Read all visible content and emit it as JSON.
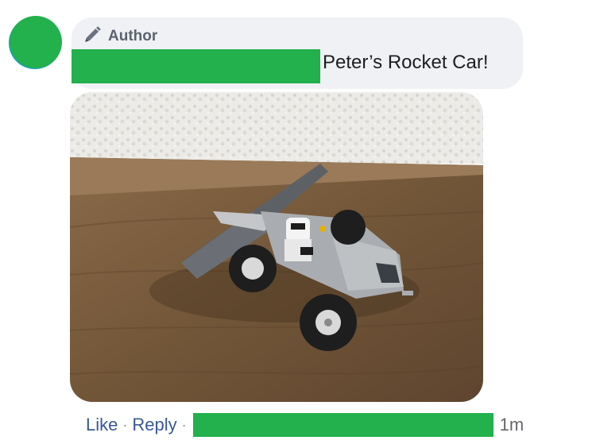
{
  "comment": {
    "badge_icon": "pen-icon",
    "badge_label": "Author",
    "text": "Peter’s Rocket Car!",
    "image_alt": "Lego rocket car on a wooden table"
  },
  "actions": {
    "like": "Like",
    "separator": "·",
    "reply": "Reply",
    "timestamp": "1m"
  },
  "colors": {
    "redaction": "#22b14c",
    "bubble": "#eff1f4",
    "link": "#385898"
  }
}
